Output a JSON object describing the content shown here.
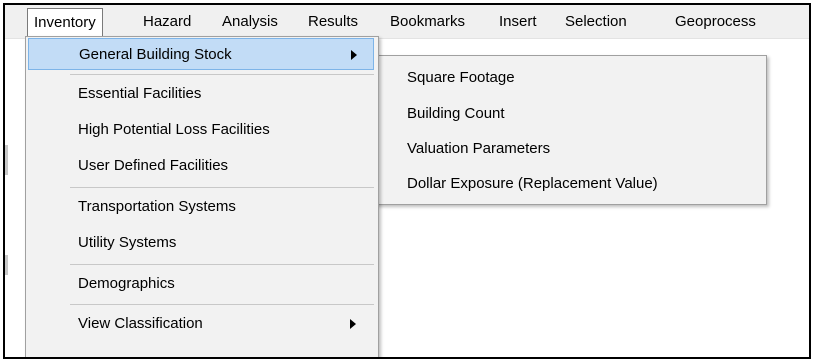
{
  "menubar": {
    "items": [
      "Inventory",
      "Hazard",
      "Analysis",
      "Results",
      "Bookmarks",
      "Insert",
      "Selection",
      "Geoprocess"
    ]
  },
  "inventory_menu": {
    "items": [
      {
        "label": "General Building Stock",
        "has_submenu": true,
        "highlighted": true
      },
      {
        "label": "Essential Facilities"
      },
      {
        "label": "High Potential Loss Facilities"
      },
      {
        "label": "User Defined Facilities"
      },
      {
        "label": "Transportation Systems"
      },
      {
        "label": "Utility Systems"
      },
      {
        "label": "Demographics"
      },
      {
        "label": "View Classification",
        "has_submenu": true
      }
    ]
  },
  "submenu": {
    "items": [
      "Square Footage",
      "Building Count",
      "Valuation Parameters",
      "Dollar Exposure (Replacement Value)"
    ]
  },
  "colors": {
    "highlight": "#c2dcf6",
    "highlight_border": "#7db4e8",
    "menu_bg": "#f2f2f2",
    "menubar_bg": "#f0f0f0"
  }
}
